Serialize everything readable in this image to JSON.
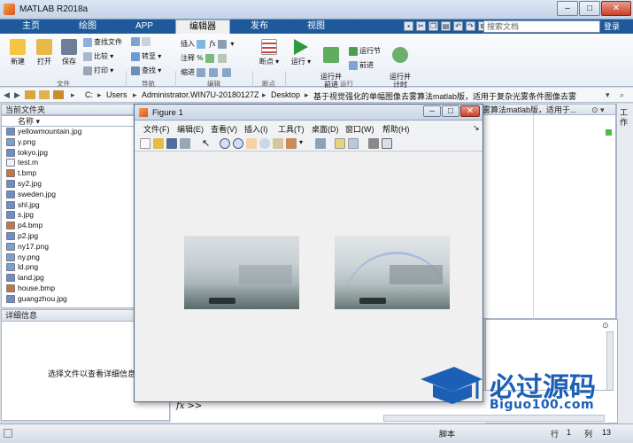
{
  "app": {
    "title": "MATLAB R2018a"
  },
  "tabs": [
    {
      "label": "主页"
    },
    {
      "label": "绘图"
    },
    {
      "label": "APP"
    },
    {
      "label": "编辑器"
    },
    {
      "label": "发布"
    },
    {
      "label": "视图"
    }
  ],
  "search": {
    "placeholder": "搜索文档"
  },
  "account": {
    "label": "登录"
  },
  "ribbon": {
    "file": {
      "new": "新建",
      "open": "打开",
      "save": "保存",
      "find_files": "查找文件",
      "compare": "比较",
      "print": "打印",
      "group": "文件"
    },
    "navigate": {
      "goto": "转至",
      "find": "查找",
      "group": "导航"
    },
    "edit": {
      "insert": "插入",
      "comment": "注释",
      "indent": "缩进",
      "fx": "fx",
      "group": "编辑"
    },
    "breakpoints": {
      "label": "断点",
      "group": "断点"
    },
    "run": {
      "run": "运行",
      "run_advance": "运行并\n前进",
      "run_section": "运行节",
      "advance": "前进",
      "run_time": "运行并\n计时",
      "group": "运行"
    }
  },
  "address": {
    "segments": [
      "C:",
      "Users",
      "Administrator.WIN7U-20180127Z",
      "Desktop",
      "基于视觉强化的单幅图像去雾算法matlab版，适用于复杂光雾条件图像去雾"
    ]
  },
  "current_folder": {
    "title": "当前文件夹",
    "column": "名称",
    "files": [
      {
        "name": "yellowmountain.jpg",
        "color": "#6b8fc8"
      },
      {
        "name": "y.png",
        "color": "#7aa0d0"
      },
      {
        "name": "tokyo.jpg",
        "color": "#6b8fc8"
      },
      {
        "name": "test.m",
        "color": "#f2f2f2"
      },
      {
        "name": "t.bmp",
        "color": "#c8773a"
      },
      {
        "name": "sy2.jpg",
        "color": "#6b8fc8"
      },
      {
        "name": "sweden.jpg",
        "color": "#6b8fc8"
      },
      {
        "name": "shl.jpg",
        "color": "#6b8fc8"
      },
      {
        "name": "s.jpg",
        "color": "#6b8fc8"
      },
      {
        "name": "p4.bmp",
        "color": "#c8773a"
      },
      {
        "name": "p2.jpg",
        "color": "#6b8fc8"
      },
      {
        "name": "ny17.png",
        "color": "#7aa0d0"
      },
      {
        "name": "ny.png",
        "color": "#7aa0d0"
      },
      {
        "name": "ld.png",
        "color": "#7aa0d0"
      },
      {
        "name": "land.jpg",
        "color": "#6b8fc8"
      },
      {
        "name": "house.bmp",
        "color": "#c8773a"
      },
      {
        "name": "guangzhou.jpg",
        "color": "#6b8fc8"
      }
    ]
  },
  "details": {
    "title": "详细信息",
    "empty": "选择文件以查看详细信息"
  },
  "editor_tab_title": "雾算法matlab版，适用于...",
  "figure": {
    "title": "Figure 1",
    "menus": [
      "文件(F)",
      "编辑(E)",
      "查看(V)",
      "插入(I)",
      "工具(T)",
      "桌面(D)",
      "窗口(W)",
      "帮助(H)"
    ]
  },
  "command": {
    "prompt": "fx >>"
  },
  "right_panel": {
    "title": "工作"
  },
  "status": {
    "mode": "脚本",
    "row_label": "行",
    "row": "1",
    "col_label": "列",
    "col": "13"
  },
  "watermark": {
    "line1": "必过源码",
    "line2": "Biguo100.com"
  },
  "colors": {
    "tab_bar": "#1e5a9b",
    "watermark": "#1b5fb6"
  }
}
